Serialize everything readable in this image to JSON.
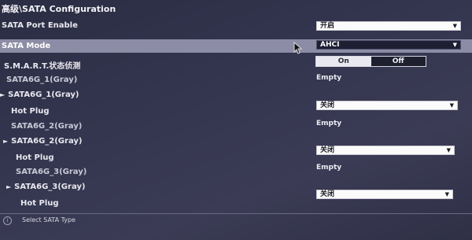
{
  "breadcrumb": "高级\\SATA Configuration",
  "rows": {
    "sata_port_enable": {
      "label": "SATA Port Enable",
      "value": "开启"
    },
    "sata_mode": {
      "label": "SATA Mode",
      "value": "AHCI"
    },
    "smart": {
      "label": "S.M.A.R.T.状态侦测",
      "on": "On",
      "off": "Off"
    },
    "sata1_info": {
      "label": "SATA6G_1(Gray)",
      "value": "Empty"
    },
    "sata1_group": {
      "label": "SATA6G_1(Gray)"
    },
    "sata1_hotplug": {
      "label": "Hot Plug",
      "value": "关闭"
    },
    "sata2_info": {
      "label": "SATA6G_2(Gray)",
      "value": "Empty"
    },
    "sata2_group": {
      "label": "SATA6G_2(Gray)"
    },
    "sata2_hotplug": {
      "label": "Hot Plug",
      "value": "关闭"
    },
    "sata3_info": {
      "label": "SATA6G_3(Gray)",
      "value": "Empty"
    },
    "sata3_group": {
      "label": "SATA6G_3(Gray)"
    },
    "sata3_hotplug": {
      "label": "Hot Plug",
      "value": "关闭"
    }
  },
  "help_text": "Select SATA Type",
  "icons": {
    "dropdown": "chevron-down-icon",
    "expand": "triangle-right-icon",
    "info": "info-icon",
    "cursor": "mouse-pointer-icon"
  },
  "colors": {
    "highlight_row": "#8c8ca6",
    "background": "#353650"
  }
}
